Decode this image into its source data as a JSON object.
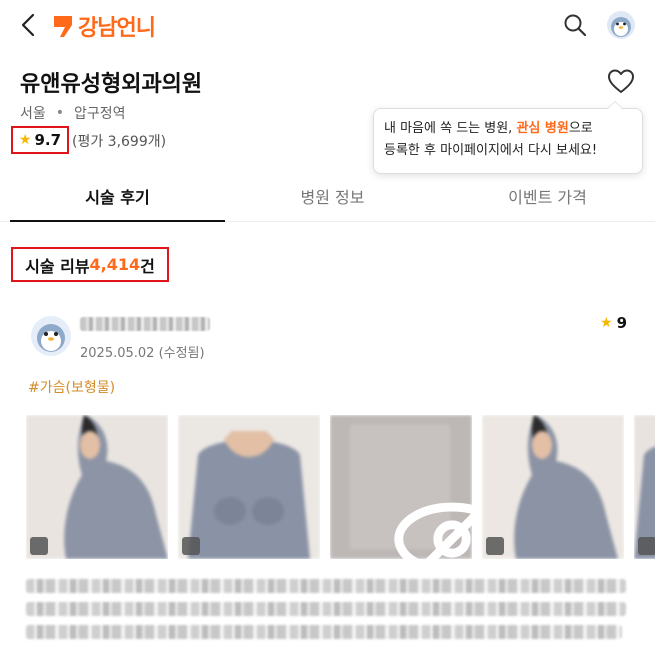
{
  "header": {
    "logo_text": "강남언니",
    "brand_color": "#ff6a1a"
  },
  "hospital": {
    "name": "유앤유성형외과의원",
    "city": "서울",
    "separator": "•",
    "district": "압구정역",
    "rating": "9.7",
    "rating_count": "(평가 3,699개)"
  },
  "tooltip": {
    "line1_pre": "내 마음에 쏙 드는 병원, ",
    "line1_highlight": "관심 병원",
    "line1_post": "으로",
    "line2": "등록한 후 마이페이지에서 다시 보세요!"
  },
  "tabs": [
    {
      "label": "시술 후기",
      "active": true
    },
    {
      "label": "병원 정보",
      "active": false
    },
    {
      "label": "이벤트 가격",
      "active": false
    }
  ],
  "reviews_summary": {
    "prefix": "시술 리뷰 ",
    "count": "4,414",
    "suffix": "건"
  },
  "review": {
    "date": "2025.05.02 (수정됨)",
    "rating": "9",
    "hashtag": "#가슴(보형물)"
  },
  "icons": {
    "back": "chevron-left-icon",
    "search": "search-icon",
    "heart": "heart-outline-icon",
    "star": "star-icon",
    "hidden_photo": "eye-off-icon"
  },
  "colors": {
    "accent": "#ff6a1a",
    "annotation_box": "#e0141b",
    "star": "#f5b800",
    "hashtag": "#d48b2a"
  }
}
